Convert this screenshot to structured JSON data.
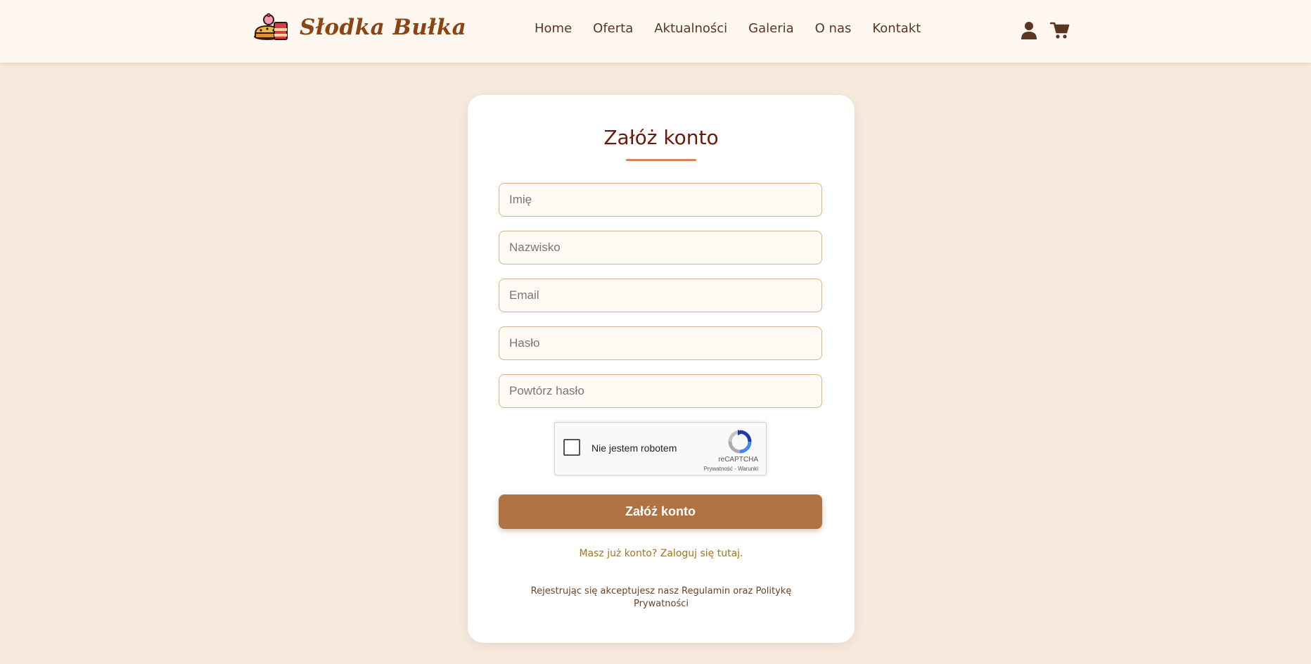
{
  "brand": {
    "name": "Słodka Bułka"
  },
  "nav": {
    "items": [
      {
        "label": "Home"
      },
      {
        "label": "Oferta"
      },
      {
        "label": "Aktualności"
      },
      {
        "label": "Galeria"
      },
      {
        "label": "O nas"
      },
      {
        "label": "Kontakt"
      }
    ]
  },
  "header_icons": [
    "user-icon",
    "cart-icon"
  ],
  "form": {
    "title": "Załóż konto",
    "fields": [
      {
        "placeholder": "Imię",
        "value": ""
      },
      {
        "placeholder": "Nazwisko",
        "value": ""
      },
      {
        "placeholder": "Email",
        "value": ""
      },
      {
        "placeholder": "Hasło",
        "value": ""
      },
      {
        "placeholder": "Powtórz hasło",
        "value": ""
      }
    ],
    "recaptcha": {
      "label": "Nie jestem robotem",
      "brand": "reCAPTCHA",
      "links": "Prywatność - Warunki",
      "checked": false
    },
    "submit_label": "Załóż konto",
    "login_link": "Masz już konto? Zaloguj się tutaj.",
    "terms": "Rejestrując się akceptujesz nasz Regulamin oraz Politykę Prywatności"
  },
  "colors": {
    "page_background": "#f6eadd",
    "header_background": "#fff8f1",
    "brand": "#8b4513",
    "title": "#6b1a0a",
    "accent_button": "#b07242",
    "link": "#a8741e"
  }
}
